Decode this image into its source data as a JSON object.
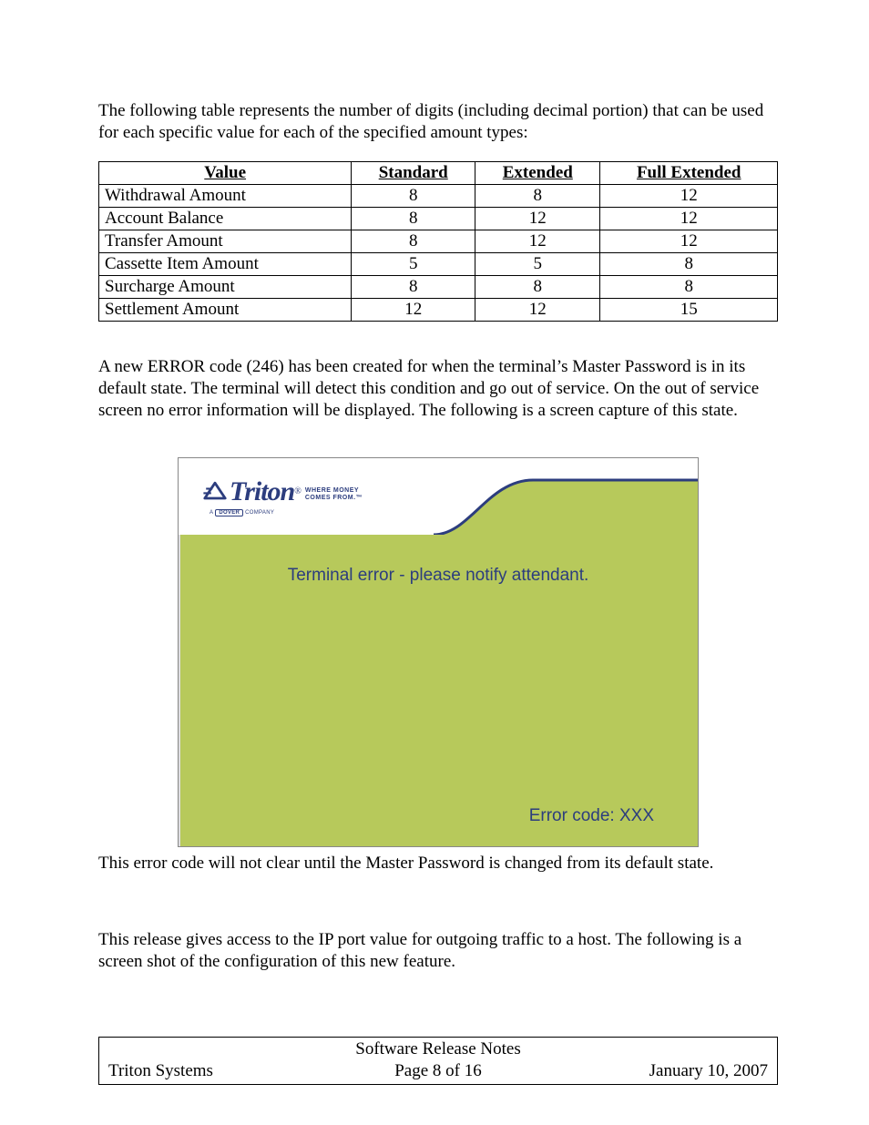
{
  "intro": "The following table represents the number of digits (including decimal portion) that can be used for each specific value for each of the specified amount types:",
  "table": {
    "headers": [
      "Value",
      "Standard",
      "Extended",
      "Full Extended"
    ],
    "rows": [
      {
        "label": "Withdrawal Amount",
        "standard": "8",
        "extended": "8",
        "full": "12"
      },
      {
        "label": "Account Balance",
        "standard": "8",
        "extended": "12",
        "full": "12"
      },
      {
        "label": "Transfer Amount",
        "standard": "8",
        "extended": "12",
        "full": "12"
      },
      {
        "label": "Cassette Item Amount",
        "standard": "5",
        "extended": "5",
        "full": "8"
      },
      {
        "label": "Surcharge Amount",
        "standard": "8",
        "extended": "8",
        "full": "8"
      },
      {
        "label": "Settlement Amount",
        "standard": "12",
        "extended": "12",
        "full": "15"
      }
    ]
  },
  "para2": "A new ERROR code (246) has been created for when the terminal’s Master Password is in its default state.  The terminal will detect this condition and go out of service.  On the out of service screen no error information will be displayed.  The following is a screen capture of this state.",
  "screen": {
    "brand": "Triton",
    "tagline1": "WHERE MONEY",
    "tagline2": "COMES FROM.™",
    "sub_prefix": "A",
    "sub_box": "DOVER",
    "sub_suffix": "COMPANY",
    "message": "Terminal error - please notify attendant.",
    "error_label": "Error code: XXX"
  },
  "para3": "This error code will not clear until the Master Password is changed from its default state.",
  "para4": "This release gives access to the IP port value for outgoing traffic to a host.  The following is a screen shot of the configuration of this new feature.",
  "footer": {
    "title": "Software Release Notes",
    "left": "Triton Systems",
    "center": "Page 8 of 16",
    "right": "January 10, 2007"
  }
}
